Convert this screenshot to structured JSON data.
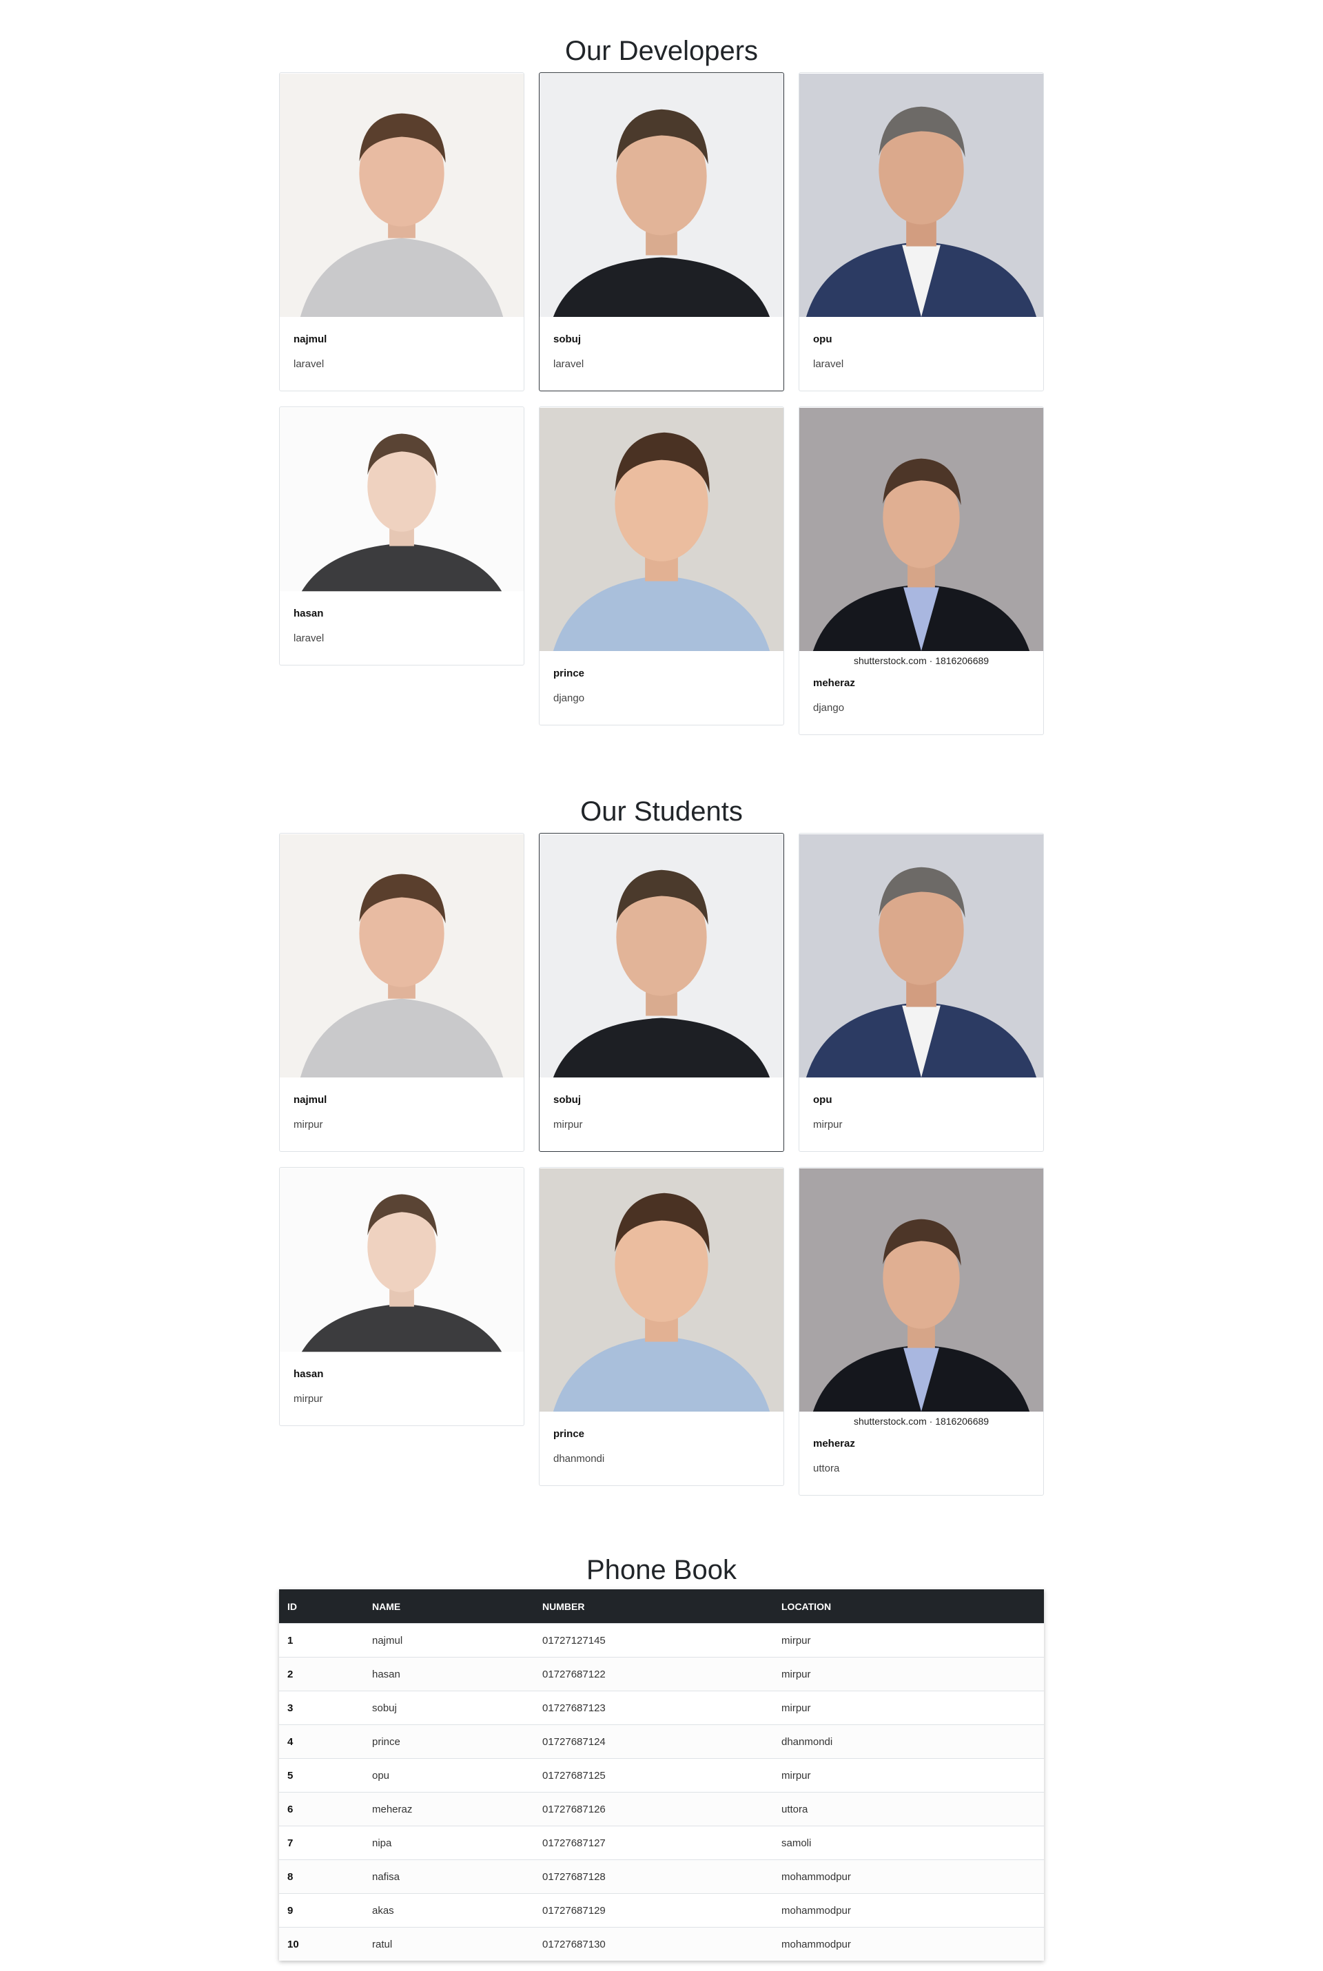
{
  "developers": {
    "title": "Our Developers",
    "cards": [
      {
        "name": "najmul",
        "sub": "laravel"
      },
      {
        "name": "sobuj",
        "sub": "laravel"
      },
      {
        "name": "opu",
        "sub": "laravel"
      },
      {
        "name": "hasan",
        "sub": "laravel"
      },
      {
        "name": "prince",
        "sub": "django"
      },
      {
        "name": "meheraz",
        "sub": "django",
        "credit": "shutterstock.com · 1816206689"
      }
    ]
  },
  "students": {
    "title": "Our Students",
    "cards": [
      {
        "name": "najmul",
        "sub": "mirpur"
      },
      {
        "name": "sobuj",
        "sub": "mirpur"
      },
      {
        "name": "opu",
        "sub": "mirpur"
      },
      {
        "name": "hasan",
        "sub": "mirpur"
      },
      {
        "name": "prince",
        "sub": "dhanmondi"
      },
      {
        "name": "meheraz",
        "sub": "uttora",
        "credit": "shutterstock.com · 1816206689"
      }
    ]
  },
  "phonebook": {
    "title": "Phone Book",
    "headers": [
      "ID",
      "NAME",
      "NUMBER",
      "LOCATION"
    ],
    "rows": [
      [
        "1",
        "najmul",
        "01727127145",
        "mirpur"
      ],
      [
        "2",
        "hasan",
        "01727687122",
        "mirpur"
      ],
      [
        "3",
        "sobuj",
        "01727687123",
        "mirpur"
      ],
      [
        "4",
        "prince",
        "01727687124",
        "dhanmondi"
      ],
      [
        "5",
        "opu",
        "01727687125",
        "mirpur"
      ],
      [
        "6",
        "meheraz",
        "01727687126",
        "uttora"
      ],
      [
        "7",
        "nipa",
        "01727687127",
        "samoli"
      ],
      [
        "8",
        "nafisa",
        "01727687128",
        "mohammodpur"
      ],
      [
        "9",
        "akas",
        "01727687129",
        "mohammodpur"
      ],
      [
        "10",
        "ratul",
        "01727687130",
        "mohammodpur"
      ]
    ]
  }
}
